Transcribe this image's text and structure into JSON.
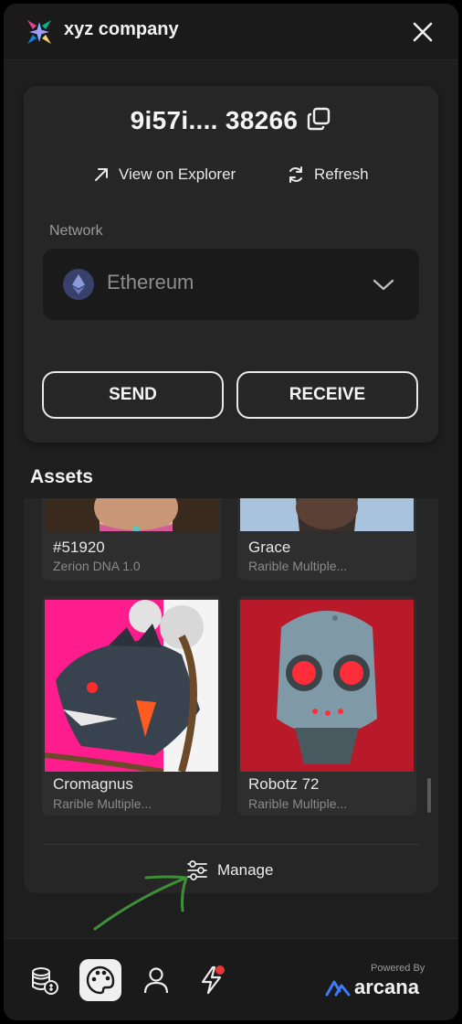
{
  "header": {
    "company_name": "xyz company",
    "logo_icon": "xyz-logo-icon",
    "close_icon": "close-icon"
  },
  "wallet": {
    "address": "9i57i.... 38266",
    "copy_icon": "copy-icon",
    "view_explorer_label": "View on Explorer",
    "refresh_label": "Refresh",
    "network_label": "Network",
    "network_value": "Ethereum",
    "send_label": "SEND",
    "receive_label": "RECEIVE"
  },
  "assets": {
    "title": "Assets",
    "items": [
      {
        "name": "#51920",
        "collection": "Zerion DNA 1.0"
      },
      {
        "name": "Grace",
        "collection": "Rarible Multiple..."
      },
      {
        "name": "Cromagnus",
        "collection": "Rarible Multiple..."
      },
      {
        "name": "Robotz 72",
        "collection": "Rarible Multiple..."
      }
    ],
    "manage_label": "Manage"
  },
  "bottom_nav": {
    "items": [
      "tokens-icon",
      "nft-palette-icon",
      "profile-icon",
      "activity-icon"
    ],
    "active": "nft-palette-icon",
    "powered_by": "Powered By",
    "brand": "arcana"
  },
  "colors": {
    "background": "#1e1e1e",
    "card": "#262626",
    "accent_blue": "#3d7bf7",
    "notification_red": "#e53935"
  }
}
